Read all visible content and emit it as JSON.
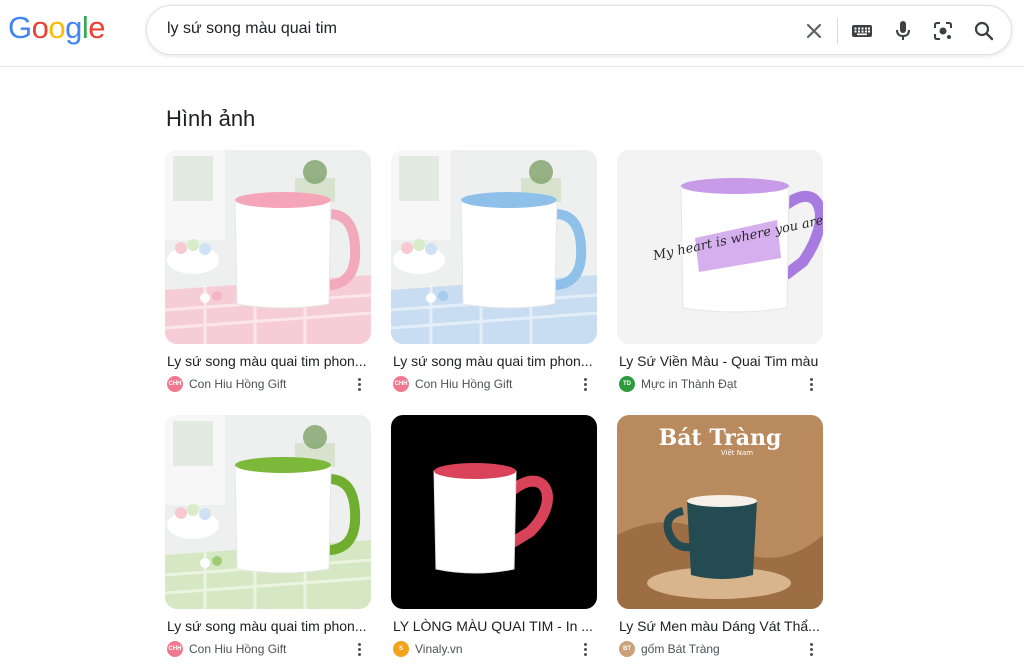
{
  "logo": {
    "letters": [
      {
        "ch": "G",
        "color": "#4285F4"
      },
      {
        "ch": "o",
        "color": "#EA4335"
      },
      {
        "ch": "o",
        "color": "#FBBC05"
      },
      {
        "ch": "g",
        "color": "#4285F4"
      },
      {
        "ch": "l",
        "color": "#34A853"
      },
      {
        "ch": "e",
        "color": "#EA4335"
      }
    ]
  },
  "search": {
    "query": "ly sứ song màu quai tim",
    "icons": [
      "clear-icon",
      "keyboard-icon",
      "microphone-icon",
      "lens-icon",
      "search-icon"
    ]
  },
  "section": {
    "title": "Hình ảnh"
  },
  "results": [
    {
      "caption": "Ly sứ song màu quai tim phon...",
      "source": "Con Hiu Hồng Gift",
      "favicon_text": "CHH",
      "favicon_color": "#ef7a8f",
      "mug_inner": "#f4a6b8",
      "mug_handle": "#f1a9bb",
      "scene": "table",
      "cloth": "#f6cdd6"
    },
    {
      "caption": "Ly sứ song màu quai tim phon...",
      "source": "Con Hiu Hồng Gift",
      "favicon_text": "CHH",
      "favicon_color": "#ef7a8f",
      "mug_inner": "#8fc0ea",
      "mug_handle": "#8fc0ea",
      "scene": "table",
      "cloth": "#c8dcf2"
    },
    {
      "caption": "Ly Sứ Viền Màu - Quai Tim màu",
      "source": "Mực in Thành Đạt",
      "favicon_text": "TD",
      "favicon_color": "#2e9a3c",
      "mug_inner": "#c79be8",
      "mug_handle": "#a87be0",
      "scene": "plain",
      "mug_text": "My heart is where you are"
    },
    {
      "caption": "Ly sứ song màu quai tim phon...",
      "source": "Con Hiu Hồng Gift",
      "favicon_text": "CHH",
      "favicon_color": "#ef7a8f",
      "mug_inner": "#7cb83a",
      "mug_handle": "#6fae2e",
      "scene": "table",
      "cloth": "#d5e8c3"
    },
    {
      "caption": "LY LÒNG MÀU QUAI TIM - In ...",
      "source": "Vinaly.vn",
      "favicon_text": "S",
      "favicon_color": "#f3a21b",
      "mug_inner": "#d9435a",
      "mug_handle": "#d9435a",
      "scene": "black"
    },
    {
      "caption": "Ly Sứ Men màu Dáng Vát Thẩ...",
      "source": "gốm Bát Tràng",
      "favicon_text": "BT",
      "favicon_color": "#c9a27a",
      "mug_inner": "#244a52",
      "mug_handle": "#244a52",
      "scene": "brown",
      "brand_title": "Bát Tràng",
      "brand_sub": "Việt Nam"
    }
  ]
}
